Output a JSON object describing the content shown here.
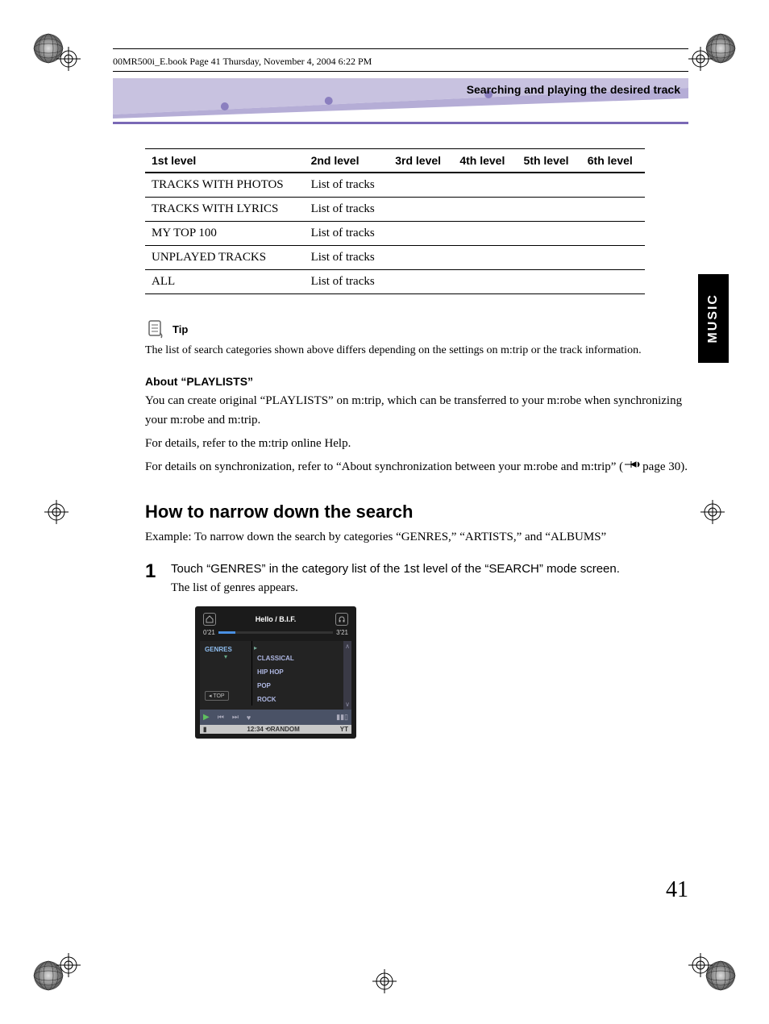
{
  "bookInfo": "00MR500i_E.book  Page 41  Thursday, November 4, 2004  6:22 PM",
  "sectionTitle": "Searching and playing the desired track",
  "sideTab": "MUSIC",
  "table": {
    "headers": [
      "1st level",
      "2nd level",
      "3rd level",
      "4th level",
      "5th level",
      "6th level"
    ],
    "rows": [
      {
        "c1": "TRACKS WITH PHOTOS",
        "c2": "List of tracks"
      },
      {
        "c1": "TRACKS WITH LYRICS",
        "c2": "List of tracks"
      },
      {
        "c1": "MY TOP 100",
        "c2": "List of tracks"
      },
      {
        "c1": "UNPLAYED TRACKS",
        "c2": "List of tracks"
      },
      {
        "c1": "ALL",
        "c2": "List of tracks"
      }
    ]
  },
  "tip": {
    "label": "Tip",
    "text": "The list of search categories shown above differs depending on the settings on m:trip or the track information."
  },
  "about": {
    "heading": "About “PLAYLISTS”",
    "p1": "You can create original “PLAYLISTS” on m:trip, which can be transferred to your m:robe when synchronizing your m:robe and m:trip.",
    "p2": "For details, refer to the m:trip online Help.",
    "p3a": "For details on synchronization, refer to “About synchronization between your m:robe and m:trip” (",
    "p3b": "page 30)."
  },
  "howto": {
    "heading": "How to narrow down the search",
    "example": "Example: To narrow down the search by categories “GENRES,” “ARTISTS,” and “ALBUMS”",
    "step1num": "1",
    "step1": "Touch “GENRES” in the category list of the 1st level of the “SEARCH” mode screen.",
    "step1sub": "The list of genres appears."
  },
  "screenshot": {
    "title": "Hello / B.I.F.",
    "time_left": "0'21",
    "time_right": "3'21",
    "left_label": "GENRES",
    "top_btn": "◂ TOP",
    "items": [
      "CLASSICAL",
      "HIP HOP",
      "POP",
      "ROCK"
    ],
    "status_time": "12:34",
    "status_mode": "RANDOM",
    "status_right": "YT"
  },
  "pageNumber": "41"
}
